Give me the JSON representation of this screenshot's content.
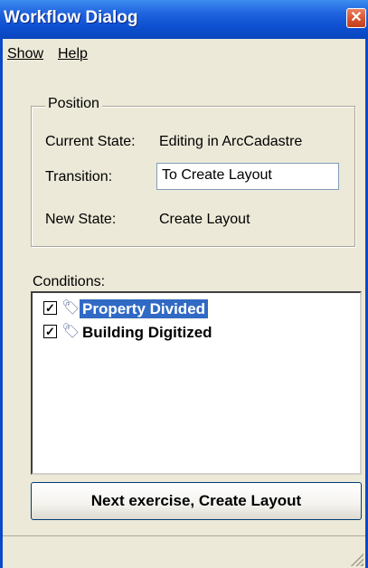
{
  "window": {
    "title": "Workflow Dialog"
  },
  "menu": {
    "items": [
      {
        "label": "Show"
      },
      {
        "label": "Help"
      }
    ]
  },
  "position": {
    "legend": "Position",
    "current_state_label": "Current State:",
    "current_state_value": "Editing in ArcCadastre",
    "transition_label": "Transition:",
    "transition_value": "To Create Layout",
    "new_state_label": "New State:",
    "new_state_value": "Create Layout"
  },
  "conditions": {
    "label": "Conditions:",
    "items": [
      {
        "label": "Property Divided",
        "checked": true,
        "selected": true,
        "icon": "tag-icon"
      },
      {
        "label": "Building Digitized",
        "checked": true,
        "selected": false,
        "icon": "tag-icon"
      }
    ]
  },
  "actions": {
    "next_label": "Next exercise, Create Layout"
  },
  "colors": {
    "titlebar": "#0c4fd0",
    "selection": "#316ac5",
    "background": "#ece9d8"
  }
}
